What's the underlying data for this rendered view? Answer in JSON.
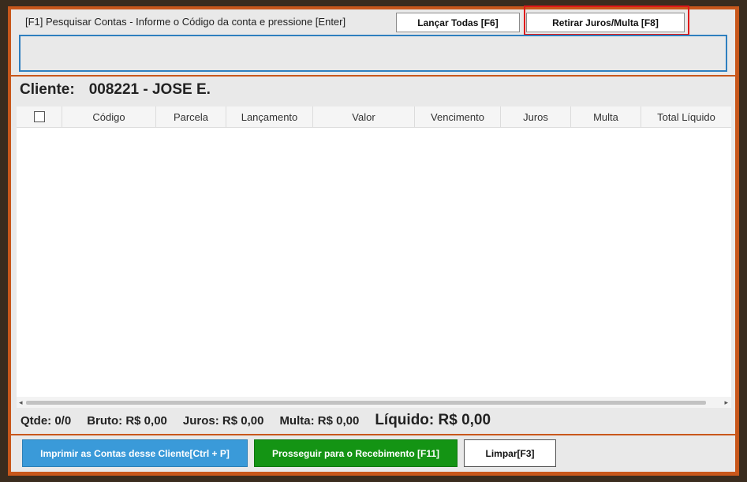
{
  "search": {
    "label": "[F1] Pesquisar Contas - Informe o Código da conta e pressione [Enter]",
    "value": ""
  },
  "top_buttons": {
    "lancar_todas": "Lançar Todas [F6]",
    "retirar_juros_multa": "Retirar Juros/Multa [F8]"
  },
  "cliente": {
    "label": "Cliente:",
    "value": "008221 - JOSE E."
  },
  "grid": {
    "columns": [
      "Código",
      "Parcela",
      "Lançamento",
      "Valor",
      "Vencimento",
      "Juros",
      "Multa",
      "Total Líquido"
    ],
    "rows": []
  },
  "totals": {
    "qtde": "Qtde: 0/0",
    "bruto": "Bruto: R$ 0,00",
    "juros": "Juros: R$ 0,00",
    "multa": "Multa: R$ 0,00",
    "liquido": "Líquido: R$ 0,00"
  },
  "footer_buttons": {
    "imprimir": "Imprimir as Contas desse Cliente[Ctrl + P]",
    "prosseguir": "Prosseguir para o Recebimento [F11]",
    "limpar": "Limpar[F3]"
  },
  "colors": {
    "frame": "#c8571b",
    "highlight": "#e01818",
    "accent_blue": "#3a9ad9",
    "accent_green": "#149414"
  }
}
